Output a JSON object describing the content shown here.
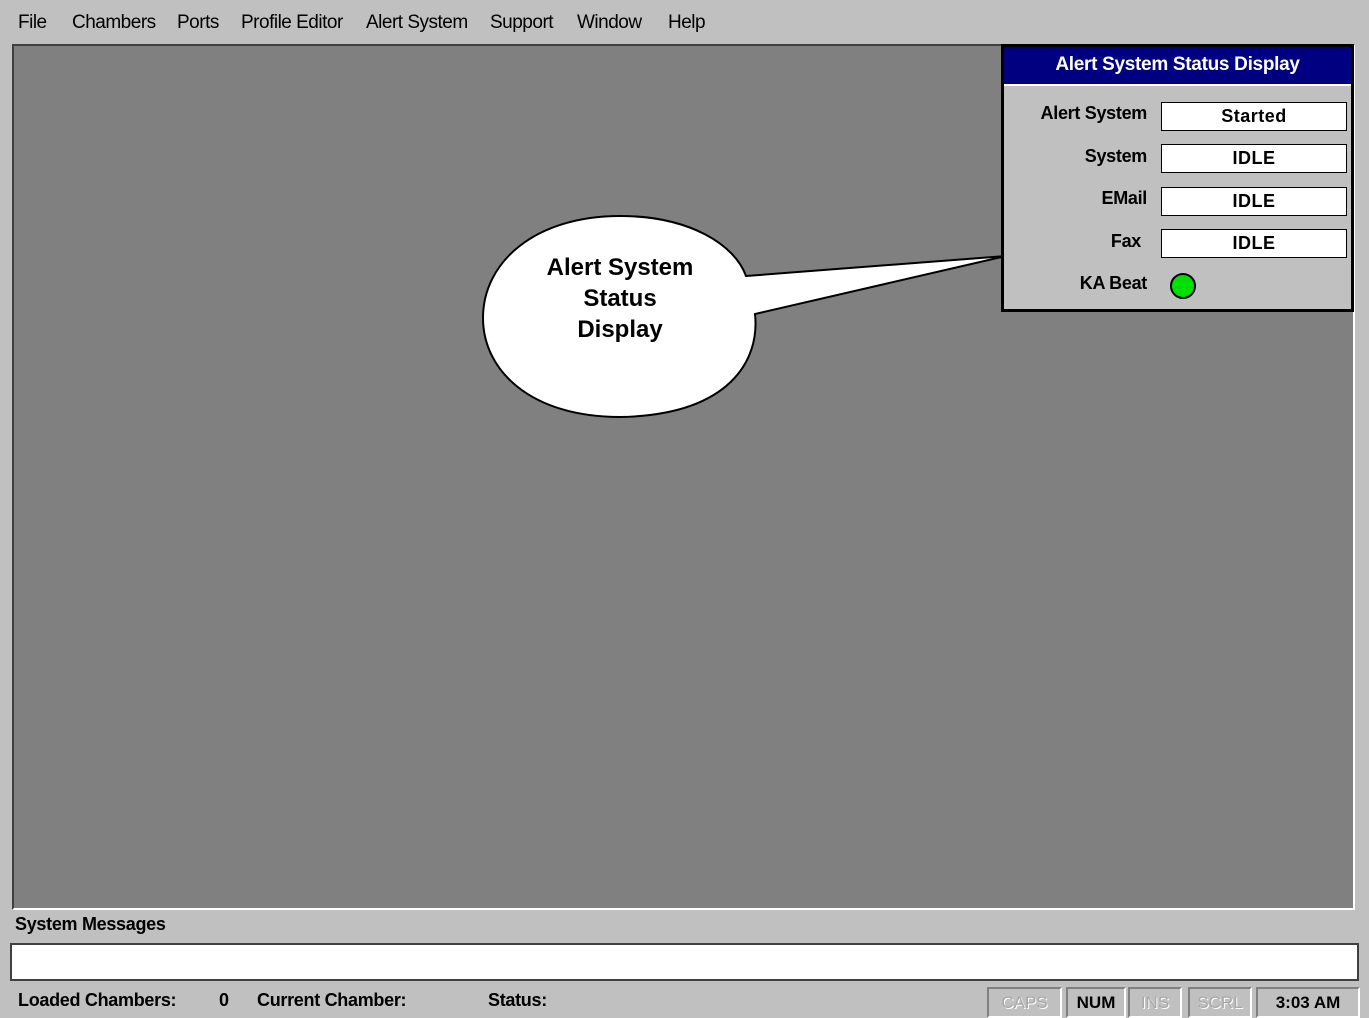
{
  "menu": [
    {
      "label": "File"
    },
    {
      "label": "Chambers"
    },
    {
      "label": "Ports"
    },
    {
      "label": "Profile Editor"
    },
    {
      "label": "Alert System"
    },
    {
      "label": "Support"
    },
    {
      "label": "Window"
    },
    {
      "label": "Help"
    }
  ],
  "status_panel": {
    "title": "Alert System Status Display",
    "rows": [
      {
        "label": "Alert System",
        "value": "Started"
      },
      {
        "label": "System",
        "value": "IDLE"
      },
      {
        "label": "EMail",
        "value": "IDLE"
      },
      {
        "label": "Fax",
        "value": "IDLE"
      }
    ],
    "ka_beat_label": "KA Beat",
    "ka_beat_color": "#00e000"
  },
  "callout": {
    "text": "Alert System\nStatus\nDisplay"
  },
  "system_messages": {
    "label": "System Messages",
    "value": ""
  },
  "statusbar": {
    "loaded_chambers_label": "Loaded Chambers:",
    "loaded_chambers_value": "0",
    "current_chamber_label": "Current Chamber:",
    "status_label": "Status:",
    "indicators": [
      "CAPS",
      "NUM",
      "INS",
      "SCRL"
    ],
    "time": "3:03 AM"
  },
  "colors": {
    "title_bar": "#000080",
    "workspace": "#808080",
    "chrome": "#c0c0c0"
  }
}
